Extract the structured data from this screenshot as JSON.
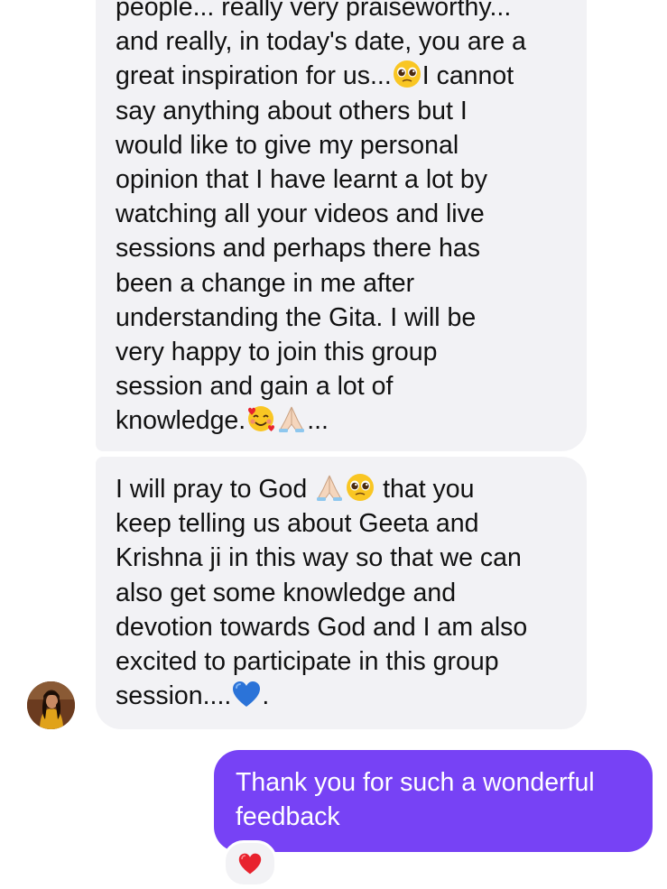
{
  "colors": {
    "incoming_bubble": "#f2f2f5",
    "outgoing_bubble": "#7742f5",
    "heart_reaction": "#e8232e"
  },
  "messages": {
    "incoming_1": {
      "lines": [
        "people... really very praiseworthy...",
        "and really, in today's date, you are a",
        "great inspiration for us...",
        "I cannot",
        "say anything about others but I",
        "would like to give my personal",
        "opinion that I have learnt a lot by",
        "watching all your videos and live",
        "sessions and perhaps there has",
        "been a change in me after",
        "understanding the Gita. I will be",
        "very happy to join this group",
        "session and gain a lot of",
        "knowledge.",
        "..."
      ]
    },
    "incoming_2": {
      "lines": [
        "I will pray to God",
        "that you",
        "keep telling us about Geeta and",
        "Krishna ji in this way so that we can",
        "also get some knowledge and",
        "devotion towards God and I am also",
        "excited to participate in this group",
        "session....",
        "."
      ]
    },
    "outgoing_1": {
      "lines": [
        "Thank you for such a wonderful",
        "feedback"
      ]
    }
  },
  "icons": {
    "pleading_face": "pleading-face-emoji",
    "smiling_hearts": "smiling-face-with-hearts-emoji",
    "folded_hands": "folded-hands-emoji",
    "blue_heart": "blue-heart-emoji",
    "red_heart": "red-heart-reaction-icon",
    "avatar": "sender-avatar"
  }
}
